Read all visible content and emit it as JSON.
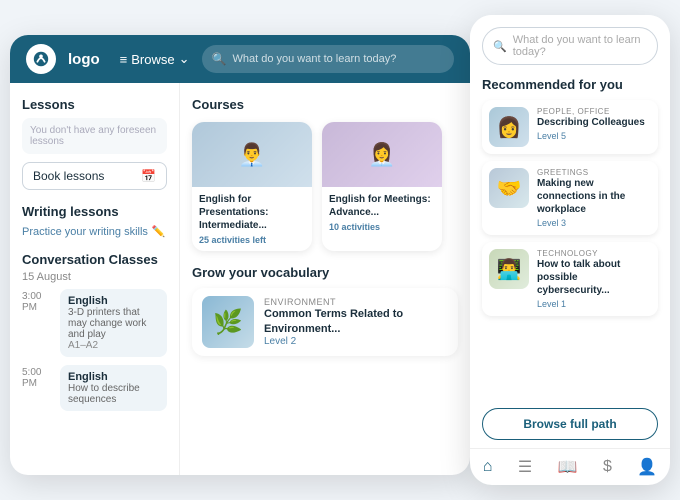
{
  "nav": {
    "logo_text": "logo",
    "browse_label": "Browse",
    "search_placeholder": "What do you want to learn today?"
  },
  "sidebar": {
    "lessons_title": "Lessons",
    "no_lessons_text": "You don't have any foreseen lessons",
    "book_lessons_label": "Book lessons",
    "writing_title": "Writing lessons",
    "writing_sub": "Practice your writing skills",
    "conv_title": "Conversation Classes",
    "date": "15 August",
    "slots": [
      {
        "time": "3:00 PM",
        "title": "English",
        "subtitle": "3-D printers that may change work and play",
        "level": "A1–A2"
      },
      {
        "time": "5:00 PM",
        "title": "English",
        "subtitle": "How to describe sequences",
        "level": ""
      }
    ]
  },
  "courses": {
    "section_title": "Courses",
    "items": [
      {
        "title": "English for Presentations: Intermediate...",
        "activities": "25 activities left"
      },
      {
        "title": "English for Meetings: Advance...",
        "activities": "10 activities"
      }
    ]
  },
  "vocabulary": {
    "section_title": "Grow your vocabulary",
    "item": {
      "tag": "ENVIRONMENT",
      "title": "Common Terms Related to Environment...",
      "level": "Level 2"
    }
  },
  "mobile": {
    "search_placeholder": "What do you want to learn today?",
    "recommended_title": "Recommended for you",
    "recommendations": [
      {
        "tag": "PEOPLE, OFFICE",
        "title": "Describing Colleagues",
        "level": "Level 5"
      },
      {
        "tag": "GREETINGS",
        "title": "Making new connections in the workplace",
        "level": "Level 3"
      },
      {
        "tag": "TECHNOLOGY",
        "title": "How to talk about possible cybersecurity...",
        "level": "Level 1"
      }
    ],
    "browse_btn": "Browse full path",
    "nav_icons": [
      "home",
      "list",
      "book",
      "dollar",
      "user"
    ]
  }
}
